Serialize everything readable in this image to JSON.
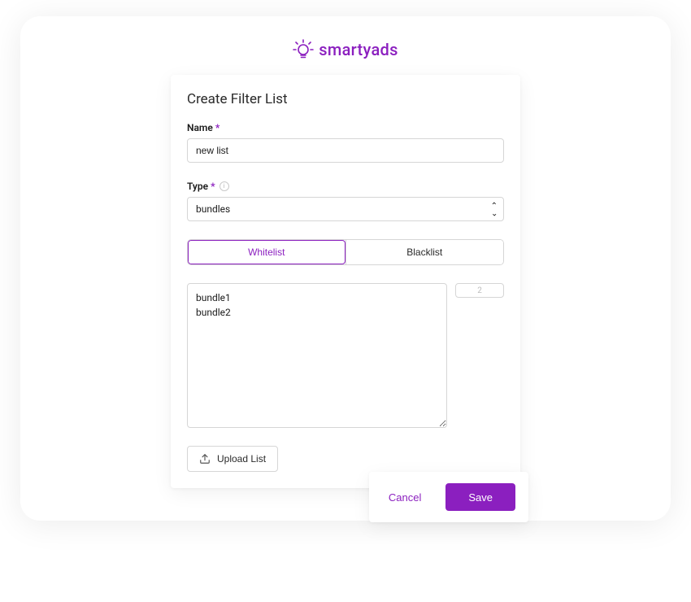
{
  "brand": {
    "name": "smartyads",
    "accent_color": "#8b1fbf"
  },
  "heading": "Create Filter List",
  "fields": {
    "name": {
      "label": "Name",
      "required_mark": "*",
      "value": "new list"
    },
    "type": {
      "label": "Type",
      "required_mark": "*",
      "selected": "bundles"
    }
  },
  "list_mode": {
    "options": [
      "Whitelist",
      "Blacklist"
    ],
    "active": "Whitelist"
  },
  "items": {
    "text": "bundle1\nbundle2",
    "count": "2"
  },
  "upload": {
    "label": "Upload List"
  },
  "footer": {
    "cancel": "Cancel",
    "save": "Save"
  }
}
